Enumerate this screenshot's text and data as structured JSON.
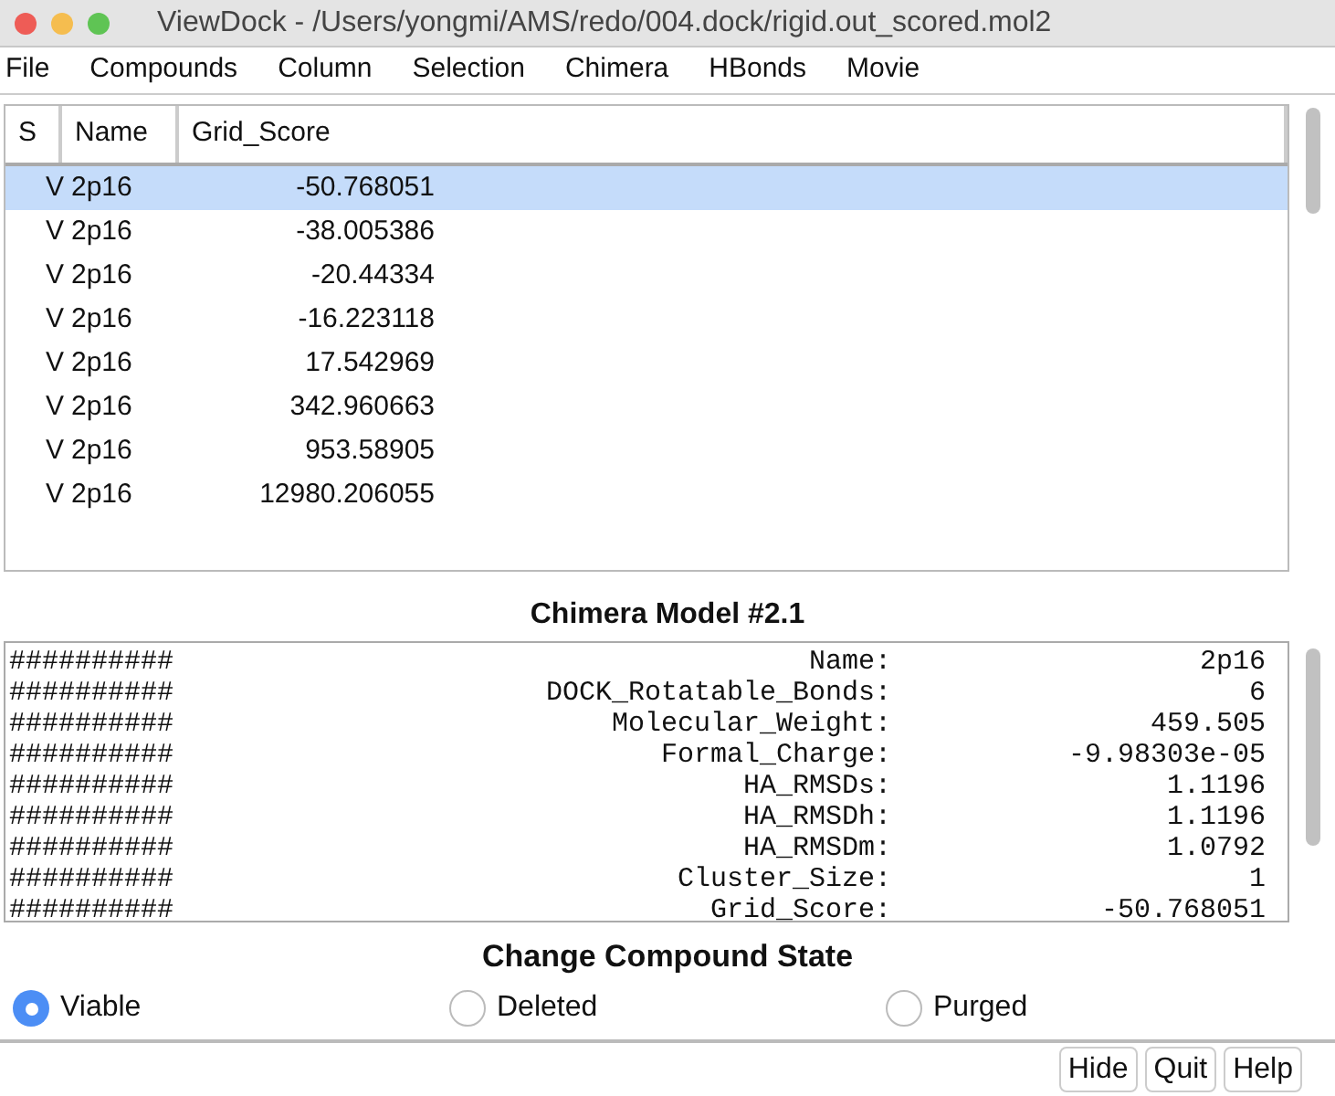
{
  "window": {
    "title": "ViewDock - /Users/yongmi/AMS/redo/004.dock/rigid.out_scored.mol2"
  },
  "menu": [
    "File",
    "Compounds",
    "Column",
    "Selection",
    "Chimera",
    "HBonds",
    "Movie"
  ],
  "table": {
    "columns": [
      "S",
      "Name",
      "Grid_Score"
    ],
    "rows": [
      {
        "cells": [
          "V",
          "2p16",
          "-50.768051"
        ],
        "selected": true
      },
      {
        "cells": [
          "V",
          "2p16",
          "-38.005386"
        ],
        "selected": false
      },
      {
        "cells": [
          "V",
          "2p16",
          "-20.44334"
        ],
        "selected": false
      },
      {
        "cells": [
          "V",
          "2p16",
          "-16.223118"
        ],
        "selected": false
      },
      {
        "cells": [
          "V",
          "2p16",
          "17.542969"
        ],
        "selected": false
      },
      {
        "cells": [
          "V",
          "2p16",
          "342.960663"
        ],
        "selected": false
      },
      {
        "cells": [
          "V",
          "2p16",
          "953.58905"
        ],
        "selected": false
      },
      {
        "cells": [
          "V",
          "2p16",
          "12980.206055"
        ],
        "selected": false
      }
    ]
  },
  "model_panel": {
    "title": "Chimera Model #2.1",
    "lines": [
      {
        "prefix": "##########",
        "label": "Name:",
        "value": "2p16"
      },
      {
        "prefix": "##########",
        "label": "DOCK_Rotatable_Bonds:",
        "value": "6"
      },
      {
        "prefix": "##########",
        "label": "Molecular_Weight:",
        "value": "459.505"
      },
      {
        "prefix": "##########",
        "label": "Formal_Charge:",
        "value": "-9.98303e-05"
      },
      {
        "prefix": "##########",
        "label": "HA_RMSDs:",
        "value": "1.1196"
      },
      {
        "prefix": "##########",
        "label": "HA_RMSDh:",
        "value": "1.1196"
      },
      {
        "prefix": "##########",
        "label": "HA_RMSDm:",
        "value": "1.0792"
      },
      {
        "prefix": "##########",
        "label": "Cluster_Size:",
        "value": "1"
      },
      {
        "prefix": "##########",
        "label": "Grid_Score:",
        "value": "-50.768051"
      }
    ]
  },
  "state_panel": {
    "title": "Change Compound State",
    "options": [
      {
        "label": "Viable",
        "selected": true
      },
      {
        "label": "Deleted",
        "selected": false
      },
      {
        "label": "Purged",
        "selected": false
      }
    ]
  },
  "buttons": [
    "Hide",
    "Quit",
    "Help"
  ]
}
